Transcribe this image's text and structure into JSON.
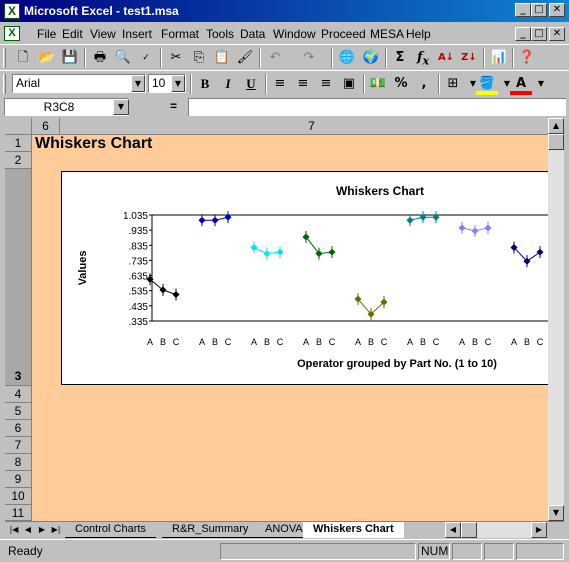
{
  "window": {
    "title": "Microsoft Excel - test1.msa",
    "app_icon": "X",
    "minimize": "_",
    "maximize": "□",
    "close": "✕"
  },
  "menu": {
    "items": [
      {
        "first": "F",
        "rest": "ile"
      },
      {
        "first": "E",
        "rest": "dit"
      },
      {
        "first": "V",
        "rest": "iew"
      },
      {
        "first": "I",
        "rest": "nsert"
      },
      {
        "first": "",
        "rest": "Format",
        "u": "o"
      },
      {
        "first": "T",
        "rest": "ools"
      },
      {
        "first": "D",
        "rest": "ata"
      },
      {
        "first": "W",
        "rest": "indow"
      },
      {
        "first": "",
        "rest": "Proceed"
      },
      {
        "first": "",
        "rest": "MESA"
      },
      {
        "first": "H",
        "rest": "elp"
      }
    ],
    "labels": [
      "File",
      "Edit",
      "View",
      "Insert",
      "Format",
      "Tools",
      "Data",
      "Window",
      "Proceed",
      "MESA",
      "Help"
    ]
  },
  "toolbar": {
    "font_name": "Arial",
    "font_size": "10",
    "bold": "B",
    "italic": "I",
    "underline": "U",
    "percent": "%",
    "comma": ",",
    "sigma": "Σ",
    "fx": "f",
    "fx_sub": "x"
  },
  "formula_bar": {
    "name_box": "R3C8",
    "equals": "=",
    "formula": ""
  },
  "sheet": {
    "columns": [
      "6",
      "7"
    ],
    "rows": [
      "1",
      "2",
      "3",
      "4",
      "5",
      "6",
      "7",
      "8",
      "9",
      "10",
      "11"
    ],
    "title_cell": "Whiskers Chart",
    "bg_color": "#ffcc99"
  },
  "chart_data": {
    "type": "line",
    "title": "Whiskers Chart",
    "ylabel": "Values",
    "xlabel": "Operator grouped by Part No. (1 to 10)",
    "ylim": [
      0.335,
      1.035
    ],
    "yticks": [
      "1.035",
      ".935",
      ".835",
      ".735",
      ".635",
      ".535",
      ".435",
      ".335"
    ],
    "operators": [
      "A",
      "B",
      "C"
    ],
    "series": [
      {
        "part": 1,
        "color": "#000000",
        "values": [
          0.61,
          0.54,
          0.51
        ]
      },
      {
        "part": 2,
        "color": "#0000cc",
        "values": [
          1.0,
          1.0,
          1.02
        ]
      },
      {
        "part": 3,
        "color": "#00e5ee",
        "values": [
          0.82,
          0.78,
          0.79
        ]
      },
      {
        "part": 4,
        "color": "#006400",
        "values": [
          0.89,
          0.78,
          0.79
        ]
      },
      {
        "part": 5,
        "color": "#6b6b00",
        "values": [
          0.48,
          0.38,
          0.46
        ]
      },
      {
        "part": 6,
        "color": "#008080",
        "values": [
          1.0,
          1.02,
          1.02
        ]
      },
      {
        "part": 7,
        "color": "#8080ff",
        "values": [
          0.95,
          0.93,
          0.95
        ]
      },
      {
        "part": 8,
        "color": "#000080",
        "values": [
          0.82,
          0.73,
          0.79
        ]
      }
    ]
  },
  "tabs": {
    "items": [
      "Control Charts",
      "R&R_Summary",
      "ANOVA",
      "Whiskers Chart"
    ],
    "active": "Whiskers Chart"
  },
  "status": {
    "ready": "Ready",
    "num": "NUM"
  }
}
